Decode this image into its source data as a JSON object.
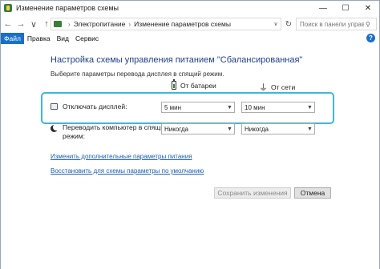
{
  "window": {
    "title": "Изменение параметров схемы",
    "controls": {
      "minimize": "—",
      "maximize": "☐",
      "close": "✕"
    }
  },
  "address": {
    "back": "←",
    "forward": "→",
    "up": "↑",
    "crumbs": [
      "Электропитание",
      "Изменение параметров схемы"
    ],
    "separator": "›",
    "dropdown": "∨",
    "refresh": "↻",
    "search_placeholder": "Поиск в панели управ..."
  },
  "menu": {
    "items": [
      "Файл",
      "Правка",
      "Вид",
      "Сервис"
    ],
    "active_index": 0,
    "help": "?"
  },
  "main": {
    "heading": "Настройка схемы управления питанием \"Сбалансированная\"",
    "subheading": "Выберите параметры перевода дисплея в спящий режим.",
    "col_battery": "От батареи",
    "col_ac": "От сети",
    "rows": [
      {
        "label": "Отключать дисплей:",
        "battery": "5 мин",
        "ac": "10 мин"
      },
      {
        "label_line1": "Переводить компьютер в спящий",
        "label_line2": "режим:",
        "battery": "Никогда",
        "ac": "Никогда"
      }
    ],
    "links": {
      "advanced": "Изменить дополнительные параметры питания",
      "restore": "Восстановить для схемы параметры по умолчанию"
    },
    "buttons": {
      "save": "Сохранить изменения",
      "cancel": "Отмена"
    }
  },
  "colors": {
    "accent": "#1a6fc9",
    "heading": "#1e3e8c",
    "highlight": "#40b6d8",
    "link": "#1a5fb4"
  }
}
